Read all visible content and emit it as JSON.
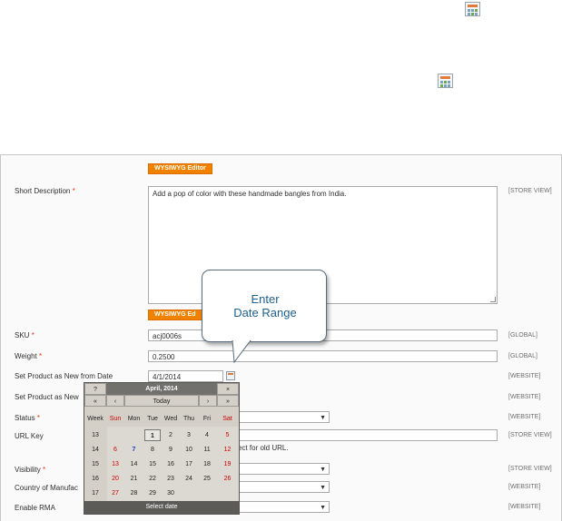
{
  "colors": {
    "accent": "#f18200",
    "required": "#eb340a",
    "callout_text": "#1b5f8f",
    "calendar_header": "#71706c"
  },
  "form": {
    "wysiwyg_label": "WYSIWYG Editor",
    "wysiwyg_label_truncated": "WYSIWYG Ed",
    "short_description": {
      "label": "Short Description",
      "required_mark": "*",
      "value": "Add a pop of color with these handmade bangles from India.",
      "scope": "[STORE VIEW]"
    },
    "sku": {
      "label": "SKU",
      "required_mark": "*",
      "value": "acj0006s",
      "scope": "[GLOBAL]"
    },
    "weight": {
      "label": "Weight",
      "required_mark": "*",
      "value": "0.2500",
      "scope": "[GLOBAL]"
    },
    "new_from": {
      "label": "Set Product as New from Date",
      "value": "4/1/2014",
      "scope": "[WEBSITE]"
    },
    "new_to": {
      "label": "Set Product as New",
      "scope": "[WEBSITE]"
    },
    "status": {
      "label": "Status",
      "required_mark": "*",
      "scope": "[WEBSITE]"
    },
    "url_key": {
      "label": "URL Key",
      "scope": "[STORE VIEW]",
      "note": "ect for old URL."
    },
    "visibility": {
      "label": "Visibility",
      "required_mark": "*",
      "scope": "[STORE VIEW]"
    },
    "country": {
      "label": "Country of Manufac",
      "scope": "[WEBSITE]"
    },
    "rma": {
      "label": "Enable RMA",
      "scope": "[WEBSITE]"
    }
  },
  "callout": {
    "line1": "Enter",
    "line2": "Date Range"
  },
  "calendar": {
    "help": "?",
    "title": "April, 2014",
    "close": "×",
    "prev_year": "«",
    "prev_month": "‹",
    "today": "Today",
    "next_month": "›",
    "next_year": "»",
    "week_header": "Week",
    "day_headers": [
      "Sun",
      "Mon",
      "Tue",
      "Wed",
      "Thu",
      "Fri",
      "Sat"
    ],
    "weeks": [
      {
        "week": "13",
        "days": [
          "",
          "",
          "1",
          "2",
          "3",
          "4",
          "5"
        ]
      },
      {
        "week": "14",
        "days": [
          "6",
          "7",
          "8",
          "9",
          "10",
          "11",
          "12"
        ]
      },
      {
        "week": "15",
        "days": [
          "13",
          "14",
          "15",
          "16",
          "17",
          "18",
          "19"
        ]
      },
      {
        "week": "16",
        "days": [
          "20",
          "21",
          "22",
          "23",
          "24",
          "25",
          "26"
        ]
      },
      {
        "week": "17",
        "days": [
          "27",
          "28",
          "29",
          "30",
          "",
          "",
          ""
        ]
      }
    ],
    "footer": "Select date",
    "selected_day": "1",
    "highlighted_day": "7"
  },
  "icons": [
    "calendar-icon"
  ]
}
